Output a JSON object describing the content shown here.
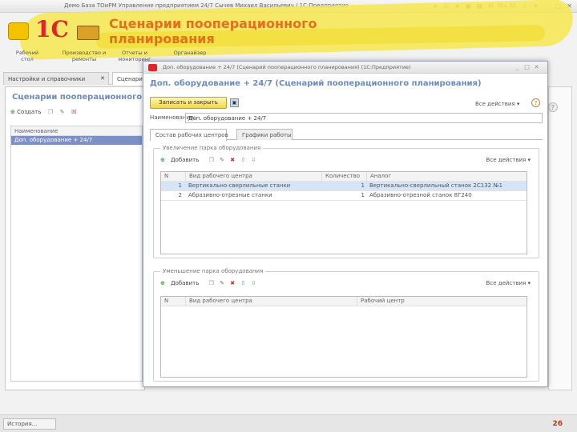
{
  "window": {
    "title": "Демо База ТОиРМ Управление предприятием 24/7 Сычев Михаил Васильевич / 1С:Предприятие",
    "controls": [
      "◂",
      "⌂",
      "★",
      "▣",
      "▦",
      "M",
      "M+",
      "M-",
      "i",
      "▾",
      "_",
      "□",
      "✕"
    ]
  },
  "slide": {
    "title": "Сценарии пооперационного планирования",
    "page_number": "26"
  },
  "logo": {
    "text": "1С"
  },
  "sections": [
    {
      "label": "Рабочий стол"
    },
    {
      "label": "Производство и ремонты"
    },
    {
      "label": "Отчеты и мониторинг"
    },
    {
      "label": "Органайзер"
    }
  ],
  "panel_tabs": [
    {
      "label": "Настройки и справочники"
    },
    {
      "label": "Сценари"
    }
  ],
  "left_panel": {
    "title": "Сценарии пооперационного",
    "create_label": "Создать",
    "list_header": "Наименование",
    "list_items": [
      {
        "label": "Доп. оборудование + 24/7",
        "selected": true
      }
    ]
  },
  "history": {
    "label": "История..."
  },
  "modal": {
    "window_title": "Доп. оборудование + 24/7 (Сценарий пооперационного планирования) (1С:Предприятие)",
    "heading": "Доп. оборудование + 24/7 (Сценарий пооперационного планирования)",
    "save_label": "Записать и закрыть",
    "all_actions": "Все действия",
    "name_label": "Наименование:",
    "name_value": "Доп. оборудование + 24/7",
    "tabs": [
      {
        "label": "Состав рабочих центров",
        "active": true
      },
      {
        "label": "Графики работы",
        "active": false
      }
    ],
    "increase": {
      "label": "Увеличение парка оборудования",
      "add_label": "Добавить",
      "all_actions": "Все действия",
      "columns": [
        "N",
        "Вид рабочего центра",
        "Количество",
        "Аналог"
      ],
      "rows": [
        {
          "n": "1",
          "type": "Вертикально-сверлильные станки",
          "qty": "1",
          "analog": "Вертикально-сверлильный станок 2С132 №1",
          "selected": true
        },
        {
          "n": "2",
          "type": "Абразивно-отрезные станки",
          "qty": "1",
          "analog": "Абразивно-отрезной станок 8Г240",
          "selected": false
        }
      ]
    },
    "decrease": {
      "label": "Уменьшение парка оборудования",
      "add_label": "Добавить",
      "all_actions": "Все действия",
      "columns": [
        "N",
        "Вид рабочего центра",
        "Рабочий центр"
      ]
    }
  },
  "colors": {
    "accent_title": "#e66f1b",
    "header_blue": "#6d8bbb",
    "selection": "#7c90c6",
    "banner_yellow": "#f6e84f"
  }
}
